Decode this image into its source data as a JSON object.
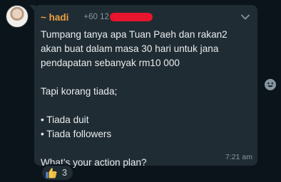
{
  "chat": {
    "sender": {
      "name": "~ hadi",
      "phone_prefix": "+60 12"
    },
    "message": {
      "lines": [
        "Tumpang tanya apa Tuan Paeh dan rakan2",
        "akan buat dalam masa 30 hari untuk jana",
        "pendapatan sebanyak rm10 000",
        "",
        "Tapi korang tiada;",
        "",
        "• Tiada duit",
        "• Tiada followers",
        "",
        "What’s your action plan?"
      ],
      "time": "7:21 am"
    },
    "reaction": {
      "emoji": "thumbs-up-icon",
      "count": "3"
    }
  },
  "colors": {
    "background": "#0b141a",
    "bubble": "#202c33",
    "sender_name": "#f0a043",
    "text": "#e9edef",
    "meta": "#8696a0",
    "redaction": "#e8152f"
  }
}
